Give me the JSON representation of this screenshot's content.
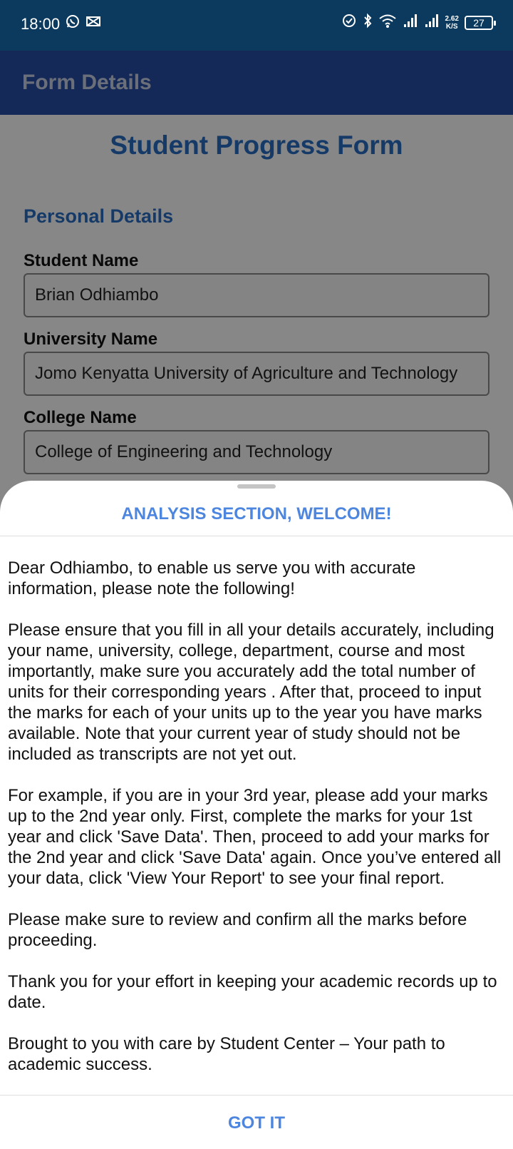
{
  "status_bar": {
    "time": "18:00",
    "left_icons": [
      "whatsapp-icon",
      "capcut-icon"
    ],
    "right_icons": [
      "sync-icon",
      "bluetooth-icon",
      "wifi-icon",
      "signal-1-icon",
      "signal-2-icon"
    ],
    "net_speed_value": "2.62",
    "net_speed_unit": "K/S",
    "battery": "27"
  },
  "app_bar": {
    "title": "Form Details"
  },
  "form": {
    "title": "Student Progress Form",
    "section": "Personal Details",
    "fields": [
      {
        "label": "Student Name",
        "value": "Brian Odhiambo"
      },
      {
        "label": "University Name",
        "value": "Jomo Kenyatta University of Agriculture and Technology"
      },
      {
        "label": "College Name",
        "value": "College of Engineering and Technology"
      }
    ]
  },
  "sheet": {
    "title": "ANALYSIS SECTION, WELCOME!",
    "paragraphs": [
      "Dear Odhiambo, to enable us serve you with accurate information, please note the following!",
      "Please ensure that you fill in all your details accurately, including your name, university, college, department, course and most importantly, make sure you accurately add the total number of units for their corresponding years . After that, proceed to input the marks for each of your units up to the year you have marks available. Note that your current year of study should not be included as transcripts are not yet out.",
      "For example, if you are in your 3rd year, please add your marks up to the 2nd year only. First, complete the marks for your 1st year and click 'Save Data'. Then, proceed to add your marks for the 2nd year and click 'Save Data' again. Once you’ve entered all your data, click 'View Your Report' to see your final report.",
      "Please make sure to review and confirm all the marks before proceeding.",
      "Thank you for your effort in keeping your academic records up to date.",
      "Brought to you with care by Student Center – Your path to academic success."
    ],
    "button": "GOT IT"
  },
  "colors": {
    "status_bar": "#0c3a5e",
    "app_bar": "#264ea6",
    "accent": "#4d86df",
    "form_heading": "#2a6fc4"
  }
}
